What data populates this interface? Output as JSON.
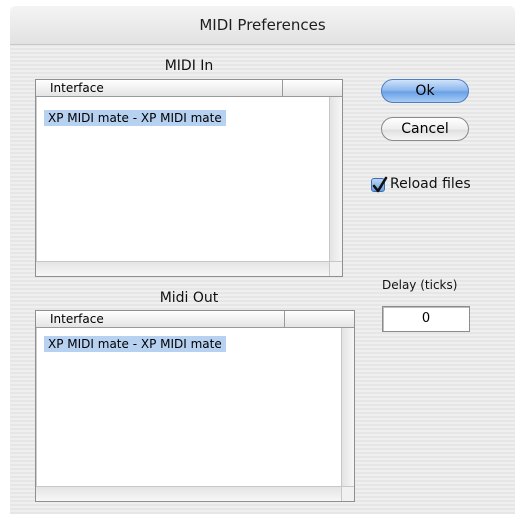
{
  "window": {
    "title": "MIDI Preferences"
  },
  "midi_in": {
    "label": "MIDI In",
    "columns": [
      "Interface",
      ""
    ],
    "rows": [
      "XP MIDI mate - XP MIDI mate"
    ]
  },
  "midi_out": {
    "label": "Midi Out",
    "columns": [
      "Interface",
      ""
    ],
    "rows": [
      "XP MIDI mate - XP MIDI mate"
    ]
  },
  "buttons": {
    "ok": "Ok",
    "cancel": "Cancel"
  },
  "reload_files": {
    "label": "Reload files",
    "checked": true
  },
  "delay": {
    "label": "Delay (ticks)",
    "value": "0"
  },
  "colors": {
    "selection": "#b7d1f1",
    "default_button": "#6aa1e6"
  },
  "icons": {
    "checkbox": "checkmark-icon"
  }
}
